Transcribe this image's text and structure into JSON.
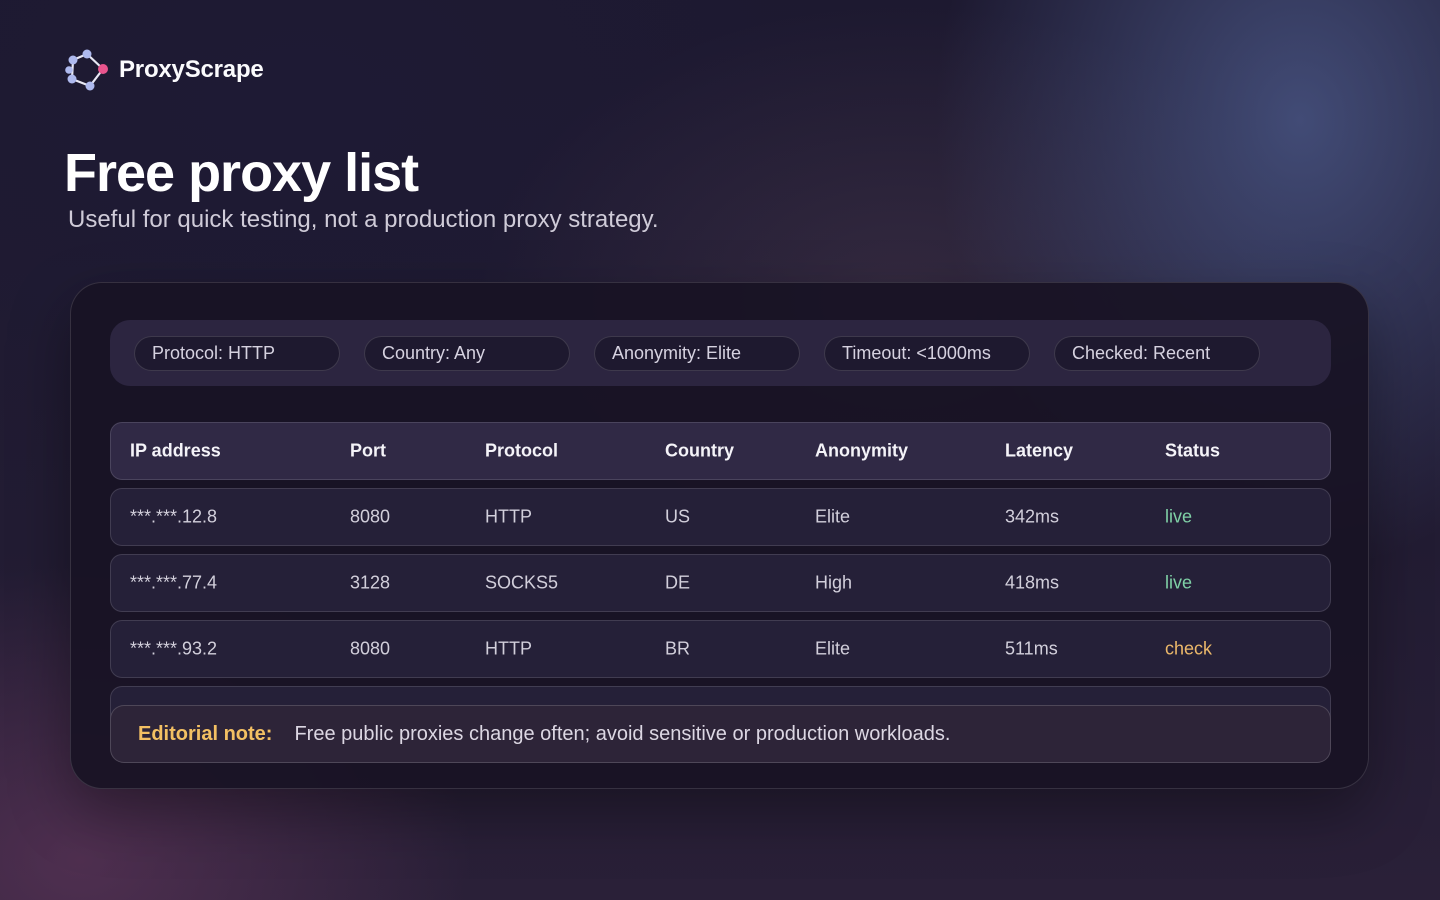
{
  "brand": {
    "name": "ProxyScrape",
    "logo_icon": "network-nodes-icon"
  },
  "page": {
    "title": "Free proxy list",
    "subtitle": "Useful for quick testing, not a production proxy strategy."
  },
  "filters": [
    {
      "label": "Protocol: HTTP"
    },
    {
      "label": "Country: Any"
    },
    {
      "label": "Anonymity: Elite"
    },
    {
      "label": "Timeout: <1000ms"
    },
    {
      "label": "Checked: Recent"
    }
  ],
  "table": {
    "headers": [
      "IP address",
      "Port",
      "Protocol",
      "Country",
      "Anonymity",
      "Latency",
      "Status"
    ],
    "rows": [
      {
        "ip": "***.***.12.8",
        "port": "8080",
        "protocol": "HTTP",
        "country": "US",
        "anonymity": "Elite",
        "latency": "342ms",
        "status": "live"
      },
      {
        "ip": "***.***.77.4",
        "port": "3128",
        "protocol": "SOCKS5",
        "country": "DE",
        "anonymity": "High",
        "latency": "418ms",
        "status": "live"
      },
      {
        "ip": "***.***.93.2",
        "port": "8080",
        "protocol": "HTTP",
        "country": "BR",
        "anonymity": "Elite",
        "latency": "511ms",
        "status": "check"
      }
    ]
  },
  "note": {
    "label": "Editorial note:",
    "text": "Free public proxies change often; avoid sensitive or production workloads."
  },
  "colors": {
    "accent_pink": "#e9548d",
    "node_blue": "#aeb9ee",
    "status_live": "#7fd0a6",
    "status_check": "#ecb86a",
    "note_label": "#f3c063"
  }
}
